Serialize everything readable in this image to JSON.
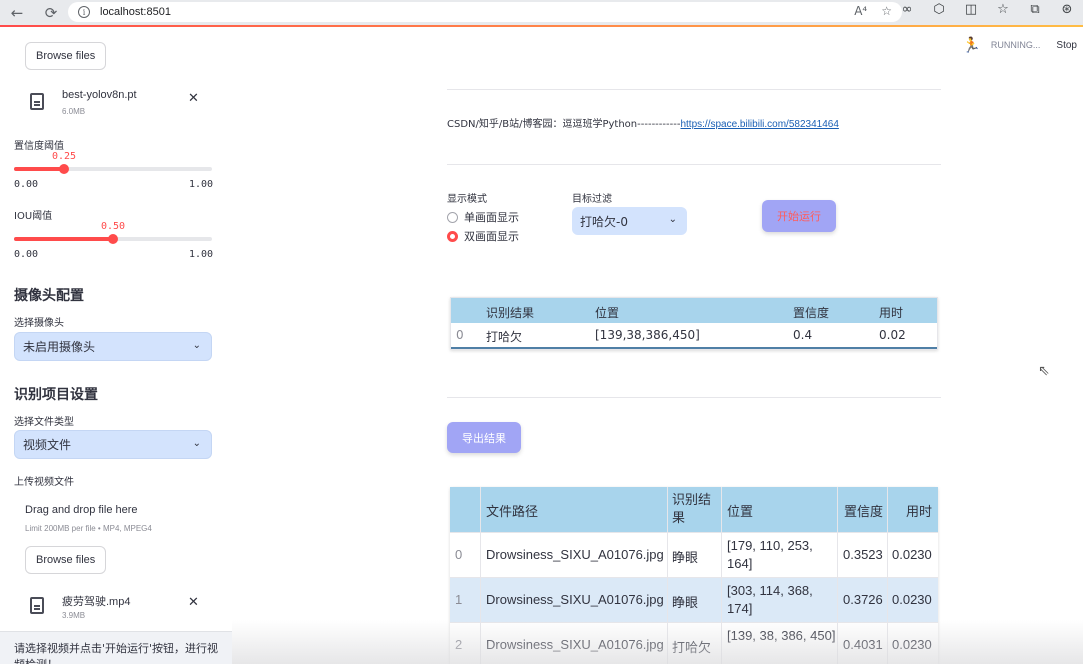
{
  "browser": {
    "url": "localhost:8501",
    "back": "←",
    "refresh": "⟳",
    "info": "i",
    "read_aloud": "A⁴",
    "favorite": "☆",
    "ext_icons": [
      "∞",
      "⬡",
      "◫",
      "☆",
      "⧉",
      "⊛"
    ]
  },
  "sidebar": {
    "top_browse_label": "Browse files",
    "model_file": {
      "name": "best-yolov8n.pt",
      "size": "6.0MB",
      "close": "✕"
    },
    "conf": {
      "label": "置信度阈值",
      "value": "0.25",
      "min": "0.00",
      "max": "1.00",
      "fraction": 0.25
    },
    "iou": {
      "label": "IOU阈值",
      "value": "0.50",
      "min": "0.00",
      "max": "1.00",
      "fraction": 0.5
    },
    "camera_section": "摄像头配置",
    "camera_label": "选择摄像头",
    "camera_value": "未启用摄像头",
    "project_section": "识别项目设置",
    "file_type_label": "选择文件类型",
    "file_type_value": "视频文件",
    "upload_label": "上传视频文件",
    "drop_text": "Drag and drop file here",
    "drop_limit": "Limit 200MB per file • MP4, MPEG4",
    "browse_label": "Browse files",
    "video_file": {
      "name": "疲劳驾驶.mp4",
      "size": "3.9MB",
      "close": "✕"
    },
    "footer_text": "请选择视频并点击'开始运行'按钮，进行视频检测！"
  },
  "main": {
    "status": {
      "running": "RUNNING...",
      "stop": "Stop"
    },
    "credit_prefix": "CSDN/知乎/B站/博客园：逗逗班学Python------------",
    "credit_link": "https://space.bilibili.com/582341464",
    "display_mode_label": "显示模式",
    "display_options": [
      "单画面显示",
      "双画面显示"
    ],
    "display_selected": "双画面显示",
    "target_filter_label": "目标过滤",
    "target_filter_value": "打哈欠-0",
    "run_button": "开始运行",
    "export_button": "导出结果"
  },
  "result_table": {
    "columns": [
      "",
      "识别结果",
      "位置",
      "置信度",
      "用时"
    ],
    "rows": [
      [
        "0",
        "打哈欠",
        "[139,38,386,450]",
        "0.4",
        "0.02"
      ]
    ]
  },
  "history_table": {
    "columns": [
      "",
      "文件路径",
      "识别结果",
      "位置",
      "置信度",
      "用时"
    ],
    "rows": [
      [
        "0",
        "Drowsiness_SIXU_A01076.jpg",
        "睁眼",
        "[179, 110, 253, 164]",
        "0.3523",
        "0.0230"
      ],
      [
        "1",
        "Drowsiness_SIXU_A01076.jpg",
        "睁眼",
        "[303, 114, 368, 174]",
        "0.3726",
        "0.0230"
      ],
      [
        "2",
        "Drowsiness_SIXU_A01076.jpg",
        "打哈欠",
        "[139, 38, 386, 450]",
        "0.4031",
        "0.0230"
      ]
    ]
  },
  "colors": {
    "accent": "#ff4b4b",
    "button_bg": "#a1a5f5",
    "select_bg": "#d3e3fd",
    "table_header": "#a8d4ec"
  }
}
